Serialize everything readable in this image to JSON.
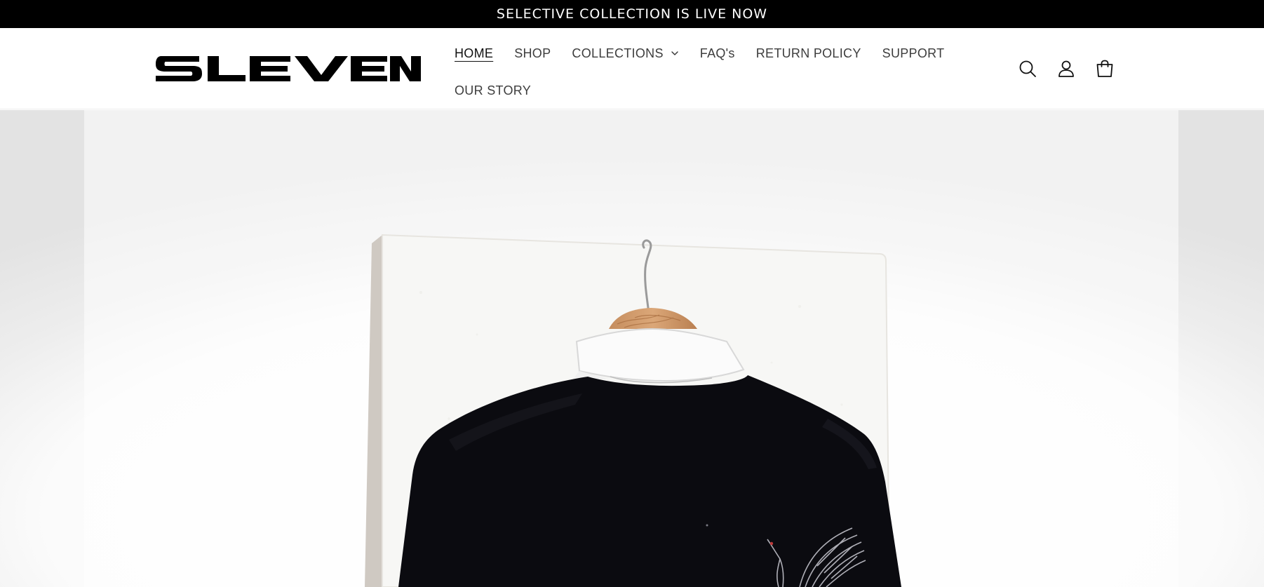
{
  "announcement": {
    "text": "SELECTIVE COLLECTION IS LIVE NOW"
  },
  "brand": {
    "logo_text": "SLEVEN"
  },
  "nav": {
    "items": [
      {
        "label": "HOME",
        "active": true
      },
      {
        "label": "SHOP"
      },
      {
        "label": "COLLECTIONS",
        "has_dropdown": true
      },
      {
        "label": "FAQ's"
      },
      {
        "label": "RETURN POLICY"
      },
      {
        "label": "SUPPORT"
      },
      {
        "label": "OUR STORY"
      }
    ]
  },
  "header_icons": [
    "search-icon",
    "account-icon",
    "cart-icon"
  ],
  "colors": {
    "announcement_bg": "#000000",
    "announcement_text": "#ffffff",
    "nav_text": "#3d3d3d",
    "jacket": "#0b0b10"
  }
}
